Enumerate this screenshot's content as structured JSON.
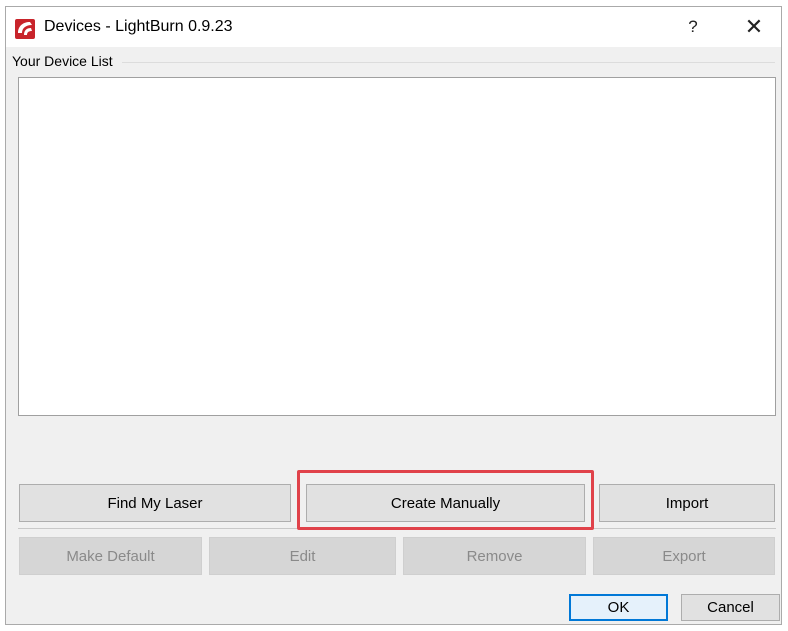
{
  "window": {
    "title": "Devices - LightBurn 0.9.23",
    "help_label": "?",
    "close_label": "✕"
  },
  "group": {
    "label": "Your Device List"
  },
  "buttons": {
    "find_my_laser": "Find My Laser",
    "create_manually": "Create Manually",
    "import": "Import",
    "make_default": "Make Default",
    "edit": "Edit",
    "remove": "Remove",
    "export": "Export",
    "ok": "OK",
    "cancel": "Cancel"
  },
  "colors": {
    "highlight": "#e0424a",
    "app_icon": "#c8242b",
    "default_button_border": "#0078d7"
  },
  "icons": {
    "app": "lightburn-app-icon"
  }
}
